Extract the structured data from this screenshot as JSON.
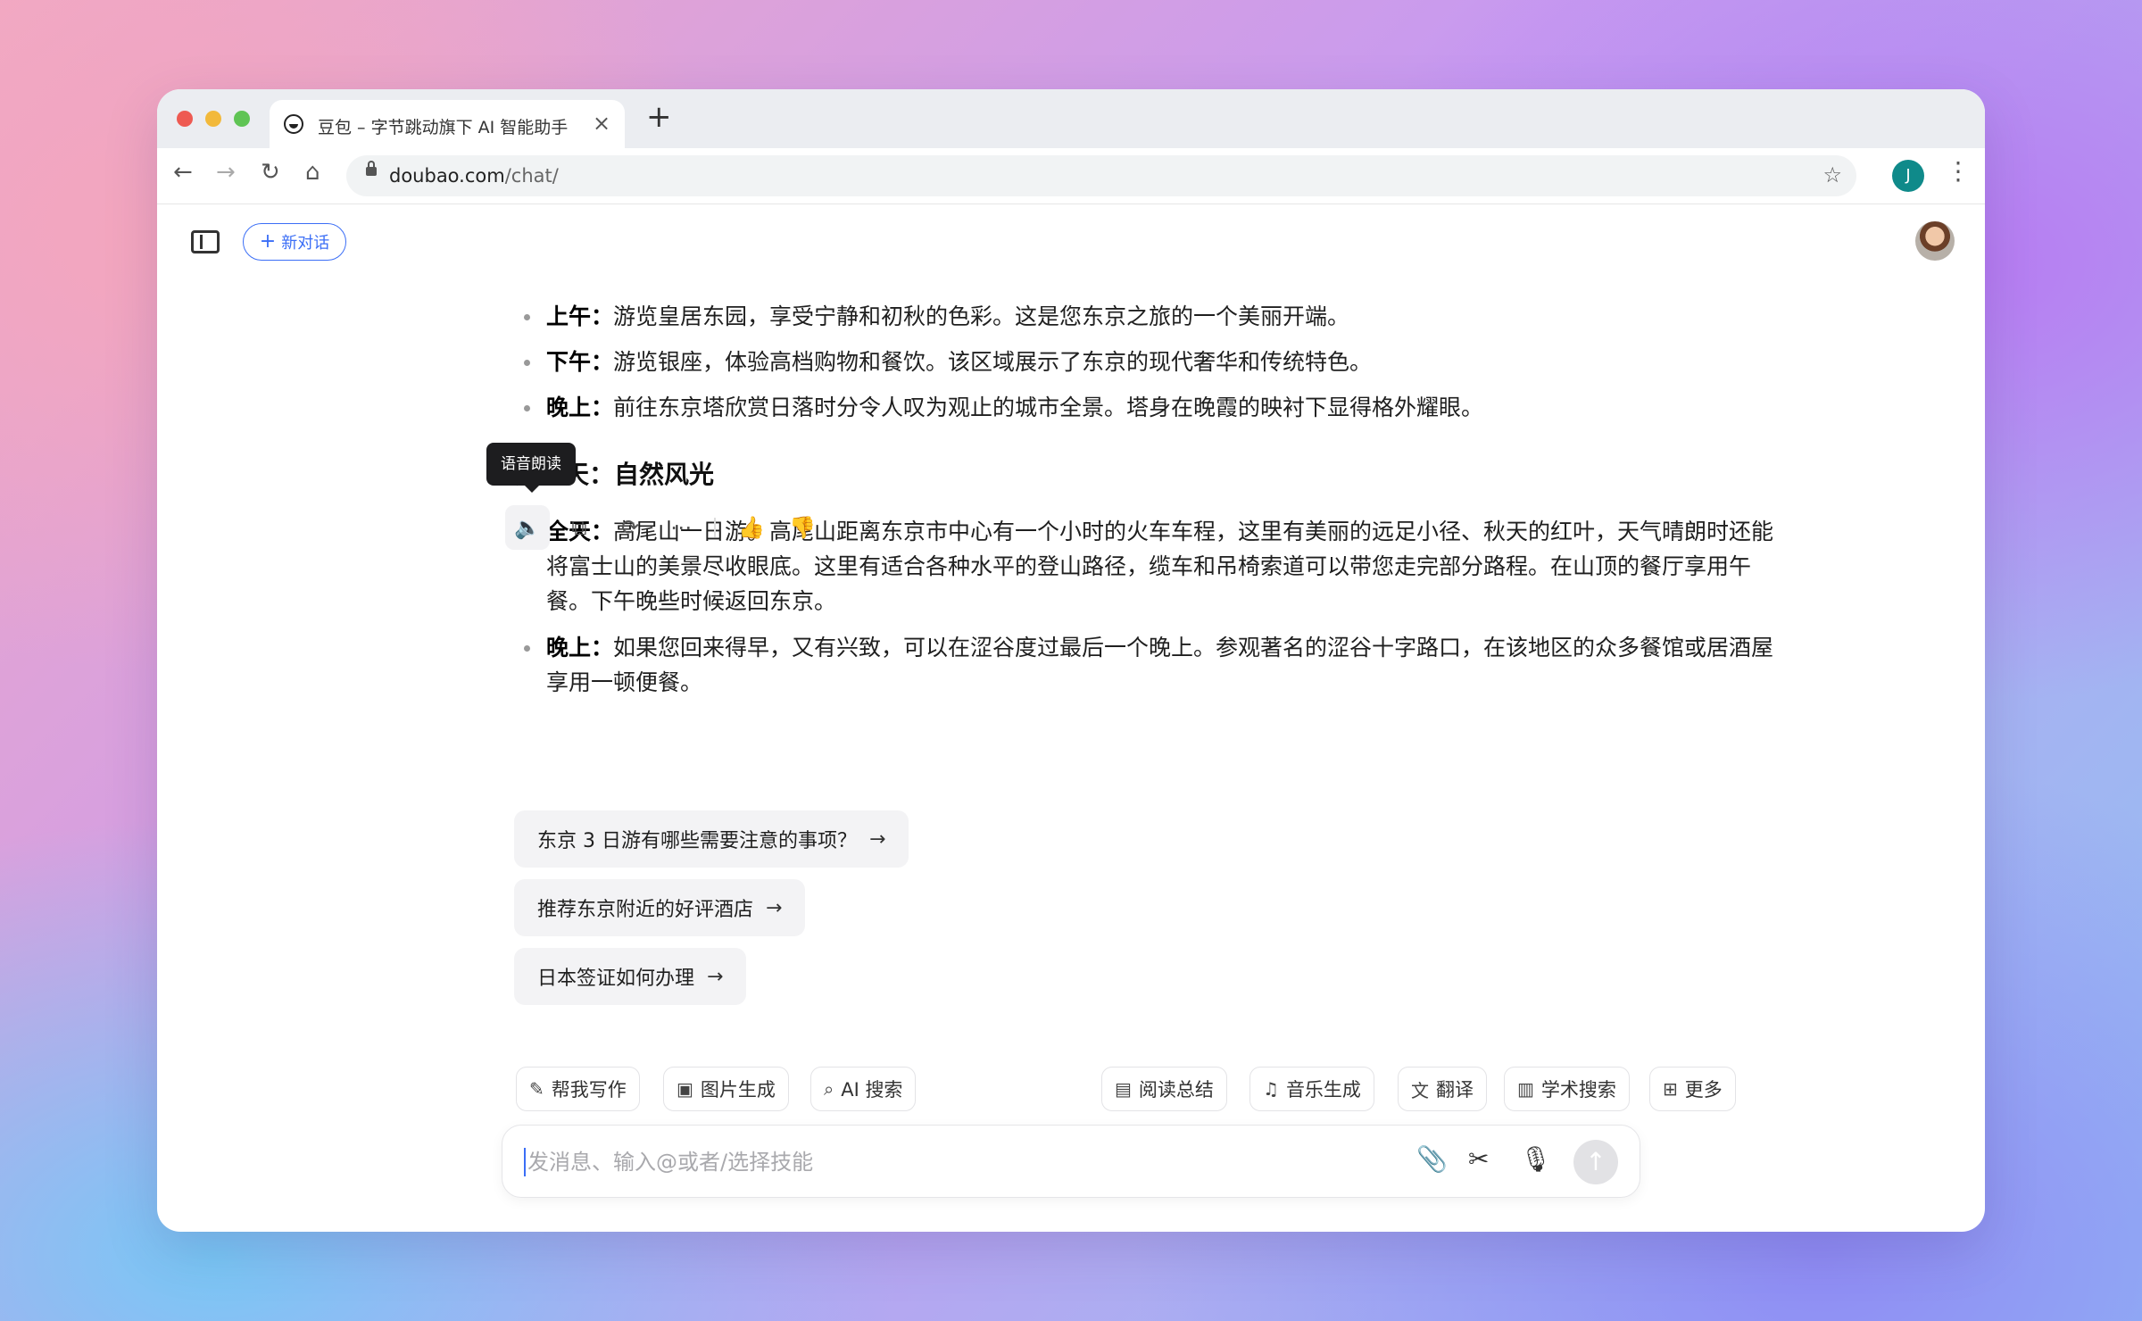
{
  "browser": {
    "tab_title": "豆包 – 字节跳动旗下 AI 智能助手",
    "url_domain": "doubao.com",
    "url_path": "/chat/",
    "profile_initial": "J"
  },
  "header": {
    "new_chat_label": "新对话"
  },
  "message": {
    "day1_items": [
      {
        "label": "上午：",
        "text": "游览皇居东园，享受宁静和初秋的色彩。这是您东京之旅的一个美丽开端。"
      },
      {
        "label": "下午：",
        "text": "游览银座，体验高档购物和餐饮。该区域展示了东京的现代奢华和传统特色。"
      },
      {
        "label": "晚上：",
        "text": "前往东京塔欣赏日落时分令人叹为观止的城市全景。塔身在晚霞的映衬下显得格外耀眼。"
      }
    ],
    "day2_heading": "第二天：自然风光",
    "day2_items": [
      {
        "label": "全天：",
        "text": "高尾山一日游。高尾山距离东京市中心有一个小时的火车车程，这里有美丽的远足小径、秋天的红叶，天气晴朗时还能将富士山的美景尽收眼底。这里有适合各种水平的登山路径，缆车和吊椅索道可以带您走完部分路程。在山顶的餐厅享用午餐。下午晚些时候返回东京。"
      },
      {
        "label": "晚上：",
        "text": "如果您回来得早，又有兴致，可以在涩谷度过最后一个晚上。参观著名的涩谷十字路口，在该地区的众多餐馆或居酒屋享用一顿便餐。"
      }
    ]
  },
  "tooltip": "语音朗读",
  "suggestions": [
    "东京 3 日游有哪些需要注意的事项？",
    "推荐东京附近的好评酒店",
    "日本签证如何办理"
  ],
  "skills": [
    "帮我写作",
    "图片生成",
    "AI 搜索",
    "阅读总结",
    "音乐生成",
    "翻译",
    "学术搜索",
    "更多"
  ],
  "composer": {
    "placeholder": "发消息、输入@或者/选择技能"
  }
}
